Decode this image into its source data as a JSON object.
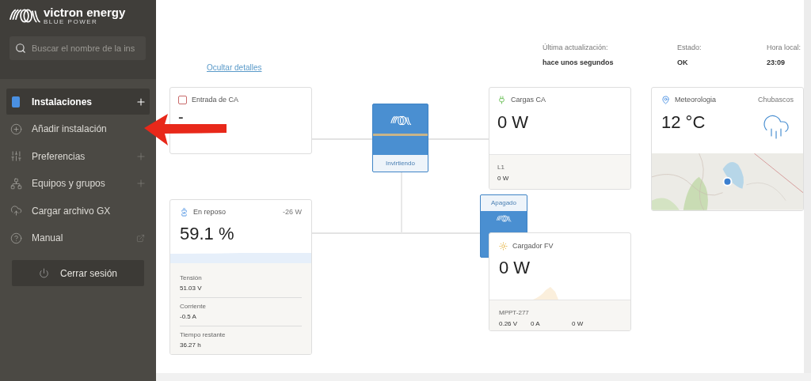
{
  "sidebar": {
    "logo": {
      "name": "victron energy",
      "tagline": "BLUE POWER"
    },
    "search": {
      "placeholder": "Buscar el nombre de la ins"
    },
    "items": [
      {
        "label": "Instalaciones",
        "kind": "installations",
        "selected": true,
        "addable": true,
        "external": false
      },
      {
        "label": "Añadir instalación",
        "kind": "add",
        "selected": false,
        "addable": false,
        "external": false
      },
      {
        "label": "Preferencias",
        "kind": "preferences",
        "selected": false,
        "addable": true,
        "external": false
      },
      {
        "label": "Equipos y grupos",
        "kind": "teams",
        "selected": false,
        "addable": true,
        "external": false
      },
      {
        "label": "Cargar archivo GX",
        "kind": "upload",
        "selected": false,
        "addable": false,
        "external": false
      },
      {
        "label": "Manual",
        "kind": "manual",
        "selected": false,
        "addable": false,
        "external": true
      }
    ],
    "logout": "Cerrar sesión"
  },
  "header": {
    "link": "Ocultar detalles",
    "info": [
      {
        "label": "Última actualización:",
        "value": "hace unos segundos"
      },
      {
        "label": "Estado:",
        "value": "OK"
      },
      {
        "label": "Hora local:",
        "value": "23:09"
      }
    ]
  },
  "ac_input": {
    "title": "Entrada de CA",
    "value": "-"
  },
  "inverter": {
    "status": "Invirtiendo"
  },
  "ac_loads": {
    "title": "Cargas CA",
    "value": "0 W",
    "phases": [
      {
        "label": "L1",
        "value": "0 W"
      }
    ]
  },
  "weather": {
    "title": "Meteorologia",
    "condition": "Chubascos",
    "temperature": "12 °C"
  },
  "battery": {
    "title": "En reposo",
    "power": "-26 W",
    "value": "59.1 %",
    "details": [
      {
        "label": "Tensión",
        "value": "51.03 V"
      },
      {
        "label": "Corriente",
        "value": "-0.5 A"
      },
      {
        "label": "Tiempo restante",
        "value": "36.27 h"
      }
    ]
  },
  "solar_charger_unit": {
    "status": "Apagado"
  },
  "pv_charger": {
    "title": "Cargador FV",
    "value": "0 W",
    "device": "MPPT-277",
    "readings": [
      "0.26 V",
      "0 A",
      "0 W"
    ]
  }
}
